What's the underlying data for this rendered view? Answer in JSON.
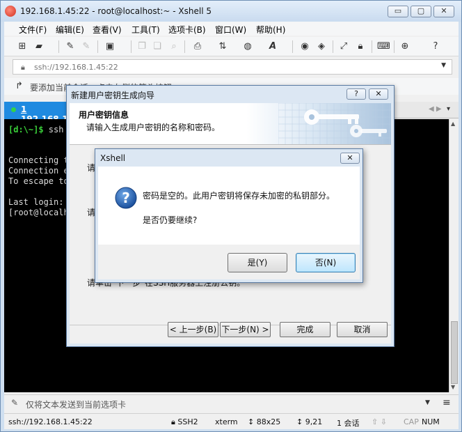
{
  "window": {
    "title": "192.168.1.45:22 - root@localhost:~ - Xshell 5",
    "controls": {
      "minimize": "▭",
      "maximize": "▢",
      "close": "✕"
    }
  },
  "menubar": {
    "items": [
      "文件(F)",
      "编辑(E)",
      "查看(V)",
      "工具(T)",
      "选项卡(B)",
      "窗口(W)",
      "帮助(H)"
    ]
  },
  "toolbar": {
    "icons": [
      "new-session-icon",
      "open-folder-icon",
      "reconnect-icon",
      "disconnect-icon",
      "properties-icon",
      "copy-icon",
      "paste-icon",
      "find-icon",
      "print-icon",
      "transfer-icon",
      "globe-icon",
      "font-icon",
      "xftp-icon",
      "xmanager-icon",
      "fullscreen-icon",
      "lock-icon",
      "keyboard-icon",
      "new-tab-icon",
      "help-icon"
    ]
  },
  "addressbar": {
    "value": "ssh://192.168.1.45:22"
  },
  "hintbar": {
    "text": "要添加当前会话，点击左侧的箭头按钮。"
  },
  "tabs": [
    {
      "number": "1",
      "label": "192.168.1"
    }
  ],
  "terminal": {
    "prompt": "[d:\\~]$",
    "command": " ssh",
    "lines": [
      "Connecting t",
      "Connection e",
      "To escape to",
      "",
      "Last login:",
      "[root@localh"
    ]
  },
  "sendbar": {
    "placeholder": "仅将文本发送到当前选项卡"
  },
  "statusbar": {
    "address": "ssh://192.168.1.45:22",
    "protocol": "SSH2",
    "term": "xterm",
    "size": "88x25",
    "cursor": "9,21",
    "sessions": "1 会话",
    "caps": "CAP",
    "num": "NUM"
  },
  "wizard": {
    "title": "新建用户密钥生成向导",
    "help_btn": "?",
    "close_btn": "✕",
    "header_title": "用户密钥信息",
    "header_subtitle": "请输入生成用户密钥的名称和密码。",
    "body_lines": [
      "请",
      "请",
      "请单击\"下一步\"在SSH服务器上注册公钥。"
    ],
    "buttons": {
      "back": "< 上一步(B)",
      "next": "下一步(N) >",
      "finish": "完成",
      "cancel": "取消"
    }
  },
  "confirm": {
    "title": "Xshell",
    "close_btn": "✕",
    "message": "密码是空的。此用户密钥将保存未加密的私钥部分。",
    "question": "是否仍要继续?",
    "yes": "是(Y)",
    "no": "否(N)"
  }
}
